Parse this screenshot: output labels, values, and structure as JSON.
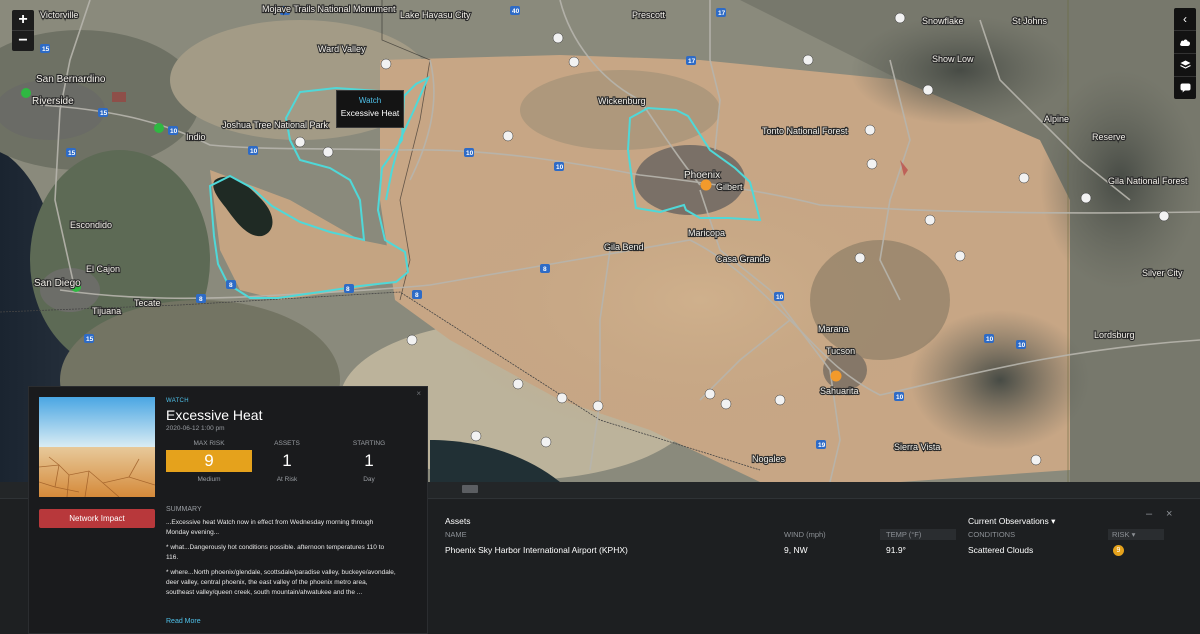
{
  "map": {
    "tooltip": {
      "tag": "Watch",
      "name": "Excessive Heat"
    },
    "labels": [
      {
        "text": "Victorville"
      },
      {
        "text": "Mojave Trails National Monument"
      },
      {
        "text": "Lake Havasu City"
      },
      {
        "text": "Prescott"
      },
      {
        "text": "Snowflake"
      },
      {
        "text": "St Johns"
      },
      {
        "text": "Show Low"
      },
      {
        "text": "San Bernardino"
      },
      {
        "text": "Riverside"
      },
      {
        "text": "Joshua Tree National Park"
      },
      {
        "text": "Indio"
      },
      {
        "text": "Wickenburg"
      },
      {
        "text": "Tonto National Forest"
      },
      {
        "text": "Alpine"
      },
      {
        "text": "Reserve"
      },
      {
        "text": "Gila National Forest"
      },
      {
        "text": "Escondido"
      },
      {
        "text": "San Diego"
      },
      {
        "text": "El Cajon"
      },
      {
        "text": "Tijuana"
      },
      {
        "text": "Tecate"
      },
      {
        "text": "Phoenix"
      },
      {
        "text": "Gilbert"
      },
      {
        "text": "Maricopa"
      },
      {
        "text": "Casa Grande"
      },
      {
        "text": "Gila Bend"
      },
      {
        "text": "Silver City"
      },
      {
        "text": "Lordsburg"
      },
      {
        "text": "Tucson"
      },
      {
        "text": "Sierra Vista"
      },
      {
        "text": "Ward Valley"
      },
      {
        "text": "Marana"
      },
      {
        "text": "Sahuarita"
      },
      {
        "text": "Nogales"
      }
    ]
  },
  "controls": {
    "zoom_in": "+",
    "zoom_out": "−",
    "collapse": "‹"
  },
  "alert": {
    "tag": "WATCH",
    "title": "Excessive Heat",
    "date": "2020-06-12 1:00 pm",
    "stats": [
      {
        "label": "MAX RISK",
        "value": "9",
        "sub": "Medium"
      },
      {
        "label": "ASSETS",
        "value": "1",
        "sub": "At Risk"
      },
      {
        "label": "STARTING",
        "value": "1",
        "sub": "Day"
      }
    ],
    "network_button": "Network Impact",
    "summary_heading": "SUMMARY",
    "summary": [
      "...Excessive heat Watch now in effect from Wednesday morning through Monday evening...",
      "* what...Dangerously hot conditions possible. afternoon temperatures 110 to 116.",
      "* where...North phoenix/glendale, scottsdale/paradise valley, buckeye/avondale, deer valley, central phoenix, the east valley of the phoenix metro area, southeast valley/queen creek, south mountain/ahwatukee and the ..."
    ],
    "read_more": "Read More",
    "close": "×"
  },
  "assets": {
    "title": "Assets",
    "observations_label": "Current Observations ▾",
    "columns": {
      "name": "NAME",
      "wind": "WIND (mph)",
      "temp": "TEMP (°F)",
      "conditions": "CONDITIONS",
      "risk": "RISK ▾"
    },
    "rows": [
      {
        "name": "Phoenix Sky Harbor International Airport (KPHX)",
        "wind": "9, NW",
        "temp": "91.9°",
        "conditions": "Scattered Clouds",
        "risk": "9"
      }
    ],
    "minimize": "–",
    "close": "×",
    "risk_color": "#e5a21c"
  }
}
